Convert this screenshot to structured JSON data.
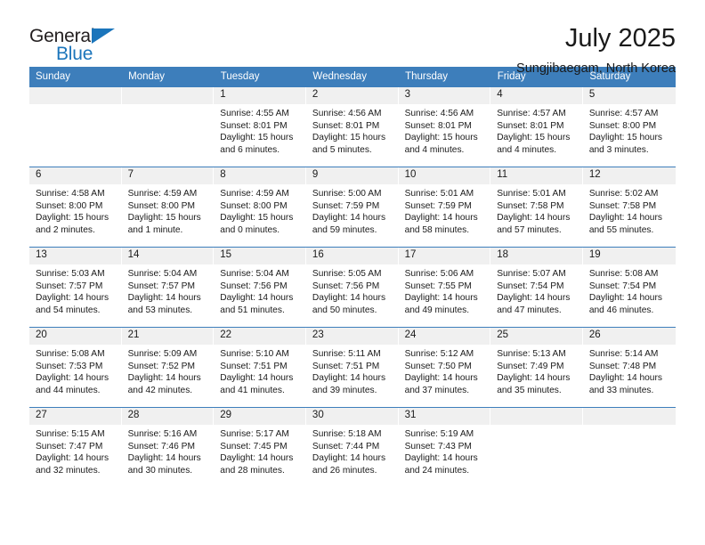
{
  "brand": {
    "name_part1": "General",
    "name_part2": "Blue",
    "triangle_icon": "triangle-icon",
    "accent_color": "#1b75bb"
  },
  "header": {
    "title": "July 2025",
    "subtitle": "Sungjibaegam, North Korea"
  },
  "calendar": {
    "header_color": "#3d7ebb",
    "daynumber_band_color": "#f0f0f0",
    "weekdays": [
      "Sunday",
      "Monday",
      "Tuesday",
      "Wednesday",
      "Thursday",
      "Friday",
      "Saturday"
    ],
    "weeks": [
      [
        {
          "day": "",
          "sunrise": "",
          "sunset": "",
          "daylight": ""
        },
        {
          "day": "",
          "sunrise": "",
          "sunset": "",
          "daylight": ""
        },
        {
          "day": "1",
          "sunrise": "Sunrise: 4:55 AM",
          "sunset": "Sunset: 8:01 PM",
          "daylight": "Daylight: 15 hours and 6 minutes."
        },
        {
          "day": "2",
          "sunrise": "Sunrise: 4:56 AM",
          "sunset": "Sunset: 8:01 PM",
          "daylight": "Daylight: 15 hours and 5 minutes."
        },
        {
          "day": "3",
          "sunrise": "Sunrise: 4:56 AM",
          "sunset": "Sunset: 8:01 PM",
          "daylight": "Daylight: 15 hours and 4 minutes."
        },
        {
          "day": "4",
          "sunrise": "Sunrise: 4:57 AM",
          "sunset": "Sunset: 8:01 PM",
          "daylight": "Daylight: 15 hours and 4 minutes."
        },
        {
          "day": "5",
          "sunrise": "Sunrise: 4:57 AM",
          "sunset": "Sunset: 8:00 PM",
          "daylight": "Daylight: 15 hours and 3 minutes."
        }
      ],
      [
        {
          "day": "6",
          "sunrise": "Sunrise: 4:58 AM",
          "sunset": "Sunset: 8:00 PM",
          "daylight": "Daylight: 15 hours and 2 minutes."
        },
        {
          "day": "7",
          "sunrise": "Sunrise: 4:59 AM",
          "sunset": "Sunset: 8:00 PM",
          "daylight": "Daylight: 15 hours and 1 minute."
        },
        {
          "day": "8",
          "sunrise": "Sunrise: 4:59 AM",
          "sunset": "Sunset: 8:00 PM",
          "daylight": "Daylight: 15 hours and 0 minutes."
        },
        {
          "day": "9",
          "sunrise": "Sunrise: 5:00 AM",
          "sunset": "Sunset: 7:59 PM",
          "daylight": "Daylight: 14 hours and 59 minutes."
        },
        {
          "day": "10",
          "sunrise": "Sunrise: 5:01 AM",
          "sunset": "Sunset: 7:59 PM",
          "daylight": "Daylight: 14 hours and 58 minutes."
        },
        {
          "day": "11",
          "sunrise": "Sunrise: 5:01 AM",
          "sunset": "Sunset: 7:58 PM",
          "daylight": "Daylight: 14 hours and 57 minutes."
        },
        {
          "day": "12",
          "sunrise": "Sunrise: 5:02 AM",
          "sunset": "Sunset: 7:58 PM",
          "daylight": "Daylight: 14 hours and 55 minutes."
        }
      ],
      [
        {
          "day": "13",
          "sunrise": "Sunrise: 5:03 AM",
          "sunset": "Sunset: 7:57 PM",
          "daylight": "Daylight: 14 hours and 54 minutes."
        },
        {
          "day": "14",
          "sunrise": "Sunrise: 5:04 AM",
          "sunset": "Sunset: 7:57 PM",
          "daylight": "Daylight: 14 hours and 53 minutes."
        },
        {
          "day": "15",
          "sunrise": "Sunrise: 5:04 AM",
          "sunset": "Sunset: 7:56 PM",
          "daylight": "Daylight: 14 hours and 51 minutes."
        },
        {
          "day": "16",
          "sunrise": "Sunrise: 5:05 AM",
          "sunset": "Sunset: 7:56 PM",
          "daylight": "Daylight: 14 hours and 50 minutes."
        },
        {
          "day": "17",
          "sunrise": "Sunrise: 5:06 AM",
          "sunset": "Sunset: 7:55 PM",
          "daylight": "Daylight: 14 hours and 49 minutes."
        },
        {
          "day": "18",
          "sunrise": "Sunrise: 5:07 AM",
          "sunset": "Sunset: 7:54 PM",
          "daylight": "Daylight: 14 hours and 47 minutes."
        },
        {
          "day": "19",
          "sunrise": "Sunrise: 5:08 AM",
          "sunset": "Sunset: 7:54 PM",
          "daylight": "Daylight: 14 hours and 46 minutes."
        }
      ],
      [
        {
          "day": "20",
          "sunrise": "Sunrise: 5:08 AM",
          "sunset": "Sunset: 7:53 PM",
          "daylight": "Daylight: 14 hours and 44 minutes."
        },
        {
          "day": "21",
          "sunrise": "Sunrise: 5:09 AM",
          "sunset": "Sunset: 7:52 PM",
          "daylight": "Daylight: 14 hours and 42 minutes."
        },
        {
          "day": "22",
          "sunrise": "Sunrise: 5:10 AM",
          "sunset": "Sunset: 7:51 PM",
          "daylight": "Daylight: 14 hours and 41 minutes."
        },
        {
          "day": "23",
          "sunrise": "Sunrise: 5:11 AM",
          "sunset": "Sunset: 7:51 PM",
          "daylight": "Daylight: 14 hours and 39 minutes."
        },
        {
          "day": "24",
          "sunrise": "Sunrise: 5:12 AM",
          "sunset": "Sunset: 7:50 PM",
          "daylight": "Daylight: 14 hours and 37 minutes."
        },
        {
          "day": "25",
          "sunrise": "Sunrise: 5:13 AM",
          "sunset": "Sunset: 7:49 PM",
          "daylight": "Daylight: 14 hours and 35 minutes."
        },
        {
          "day": "26",
          "sunrise": "Sunrise: 5:14 AM",
          "sunset": "Sunset: 7:48 PM",
          "daylight": "Daylight: 14 hours and 33 minutes."
        }
      ],
      [
        {
          "day": "27",
          "sunrise": "Sunrise: 5:15 AM",
          "sunset": "Sunset: 7:47 PM",
          "daylight": "Daylight: 14 hours and 32 minutes."
        },
        {
          "day": "28",
          "sunrise": "Sunrise: 5:16 AM",
          "sunset": "Sunset: 7:46 PM",
          "daylight": "Daylight: 14 hours and 30 minutes."
        },
        {
          "day": "29",
          "sunrise": "Sunrise: 5:17 AM",
          "sunset": "Sunset: 7:45 PM",
          "daylight": "Daylight: 14 hours and 28 minutes."
        },
        {
          "day": "30",
          "sunrise": "Sunrise: 5:18 AM",
          "sunset": "Sunset: 7:44 PM",
          "daylight": "Daylight: 14 hours and 26 minutes."
        },
        {
          "day": "31",
          "sunrise": "Sunrise: 5:19 AM",
          "sunset": "Sunset: 7:43 PM",
          "daylight": "Daylight: 14 hours and 24 minutes."
        },
        {
          "day": "",
          "sunrise": "",
          "sunset": "",
          "daylight": ""
        },
        {
          "day": "",
          "sunrise": "",
          "sunset": "",
          "daylight": ""
        }
      ]
    ]
  }
}
